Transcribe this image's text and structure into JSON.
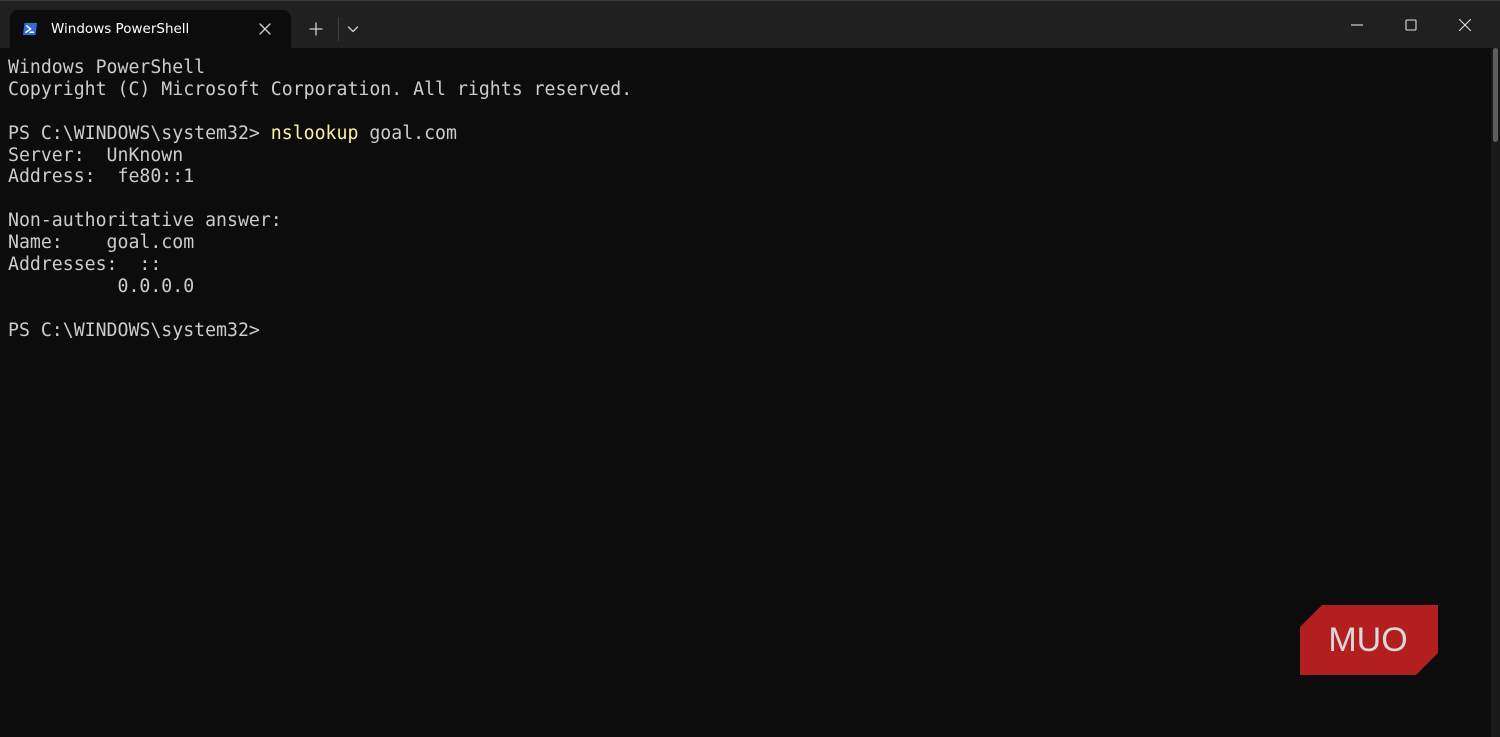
{
  "window": {
    "tab_title": "Windows PowerShell",
    "icons": {
      "tab_icon": "powershell-icon",
      "close_tab": "close-icon",
      "new_tab": "plus-icon",
      "dropdown": "chevron-down-icon",
      "minimize": "minimize-icon",
      "maximize": "maximize-icon",
      "close_window": "close-icon"
    }
  },
  "terminal": {
    "lines": [
      {
        "text": "Windows PowerShell"
      },
      {
        "text": "Copyright (C) Microsoft Corporation. All rights reserved."
      },
      {
        "text": ""
      },
      {
        "prompt": "PS C:\\WINDOWS\\system32> ",
        "command": "nslookup",
        "args": " goal.com"
      },
      {
        "text": "Server:  UnKnown"
      },
      {
        "text": "Address:  fe80::1"
      },
      {
        "text": ""
      },
      {
        "text": "Non-authoritative answer:"
      },
      {
        "text": "Name:    goal.com"
      },
      {
        "text": "Addresses:  ::"
      },
      {
        "text": "          0.0.0.0"
      },
      {
        "text": ""
      },
      {
        "prompt": "PS C:\\WINDOWS\\system32>"
      }
    ]
  },
  "watermark": {
    "text": "MUO",
    "color": "#b31e1e"
  },
  "colors": {
    "background": "#0c0c0c",
    "titlebar": "#202020",
    "foreground": "#cccccc",
    "command": "#f9f1a5",
    "powershell_blue": "#2f6fd6"
  }
}
